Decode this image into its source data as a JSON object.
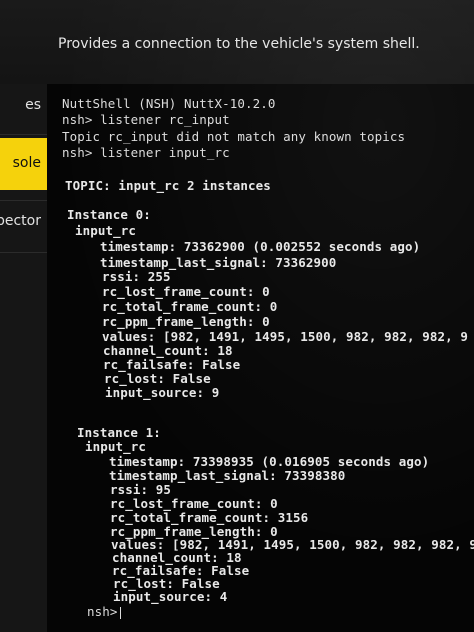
{
  "header": {
    "description": "Provides a connection to the vehicle's system shell."
  },
  "sidebar": {
    "items": [
      {
        "label": "es"
      },
      {
        "label": "sole"
      },
      {
        "label": "pector"
      }
    ],
    "active_color": "#f5d20c"
  },
  "terminal": {
    "lines": [
      "NuttShell (NSH) NuttX-10.2.0",
      "nsh> listener rc_input",
      "Topic rc_input did not match any known topics",
      "nsh> listener input_rc",
      "TOPIC: input_rc 2 instances",
      "Instance 0:",
      "input_rc",
      "timestamp: 73362900 (0.002552 seconds ago)",
      "timestamp_last_signal: 73362900",
      "rssi: 255",
      "rc_lost_frame_count: 0",
      "rc_total_frame_count: 0",
      "rc_ppm_frame_length: 0",
      "values: [982, 1491, 1495, 1500, 982, 982, 982, 9",
      "channel_count: 18",
      "rc_failsafe: False",
      "rc_lost: False",
      "input_source: 9",
      "Instance 1:",
      "input_rc",
      "timestamp: 73398935 (0.016905 seconds ago)",
      "timestamp_last_signal: 73398380",
      "rssi: 95",
      "rc_lost_frame_count: 0",
      "rc_total_frame_count: 3156",
      "rc_ppm_frame_length: 0",
      "values: [982, 1491, 1495, 1500, 982, 982, 982, 982,",
      "channel_count: 18",
      "rc_failsafe: False",
      "rc_lost: False",
      "input_source: 4",
      "nsh>"
    ]
  }
}
